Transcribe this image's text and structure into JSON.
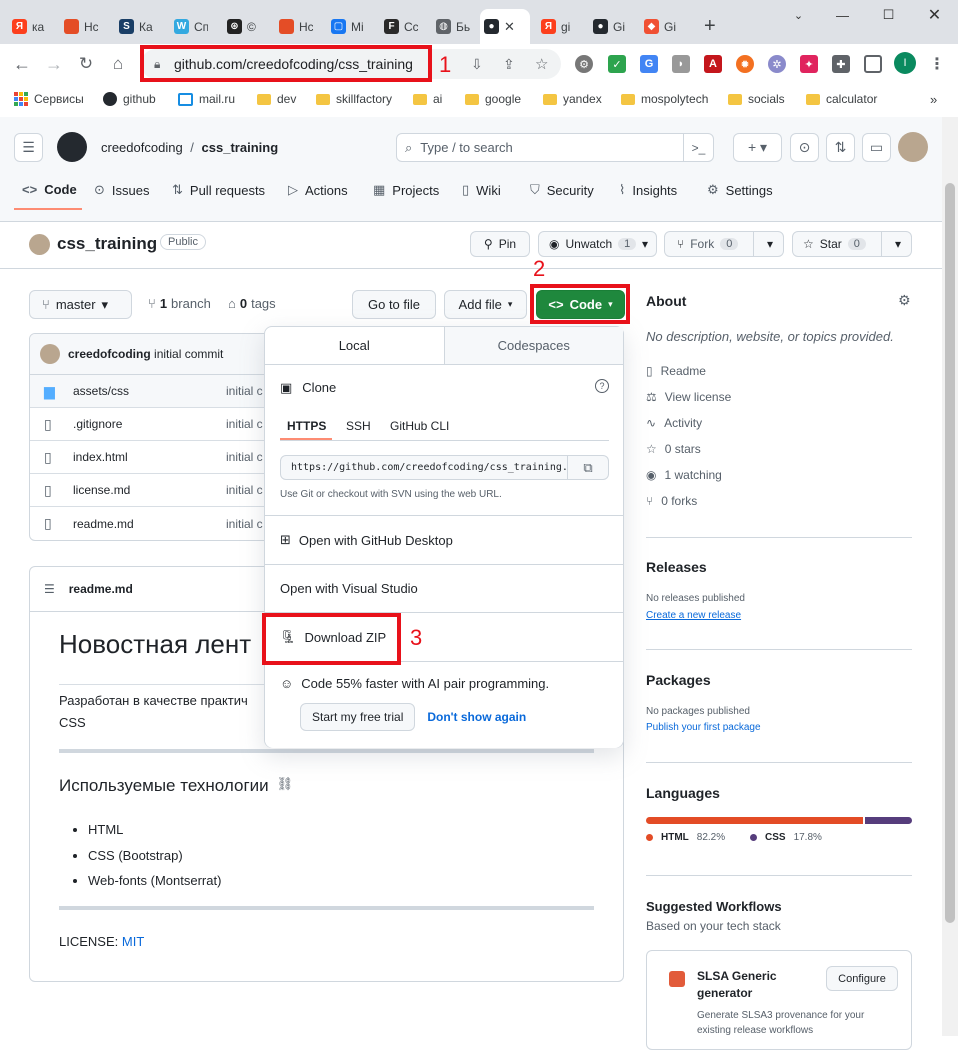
{
  "browser": {
    "tabs": [
      {
        "title": "ка",
        "icon": "yandex-icon",
        "color": "#fc3f1d",
        "glyph": "Я"
      },
      {
        "title": "Нс",
        "icon": "html5-icon",
        "color": "#e44d26",
        "glyph": ""
      },
      {
        "title": "Ка",
        "icon": "stackoverflow-icon",
        "color": "#1a3e66",
        "glyph": "S"
      },
      {
        "title": "Сп",
        "icon": "w-icon",
        "color": "#33a9e0",
        "glyph": "W"
      },
      {
        "title": "©",
        "icon": "openai-icon",
        "color": "#222222",
        "glyph": "⊛"
      },
      {
        "title": "Нс",
        "icon": "html5-icon",
        "color": "#e44d26",
        "glyph": ""
      },
      {
        "title": "Мі",
        "icon": "messenger-icon",
        "color": "#1877f2",
        "glyph": "▢"
      },
      {
        "title": "Сс",
        "icon": "figma-icon",
        "color": "#2a2a2a",
        "glyph": "F"
      },
      {
        "title": "Бь",
        "icon": "globe-icon",
        "color": "#5f6368",
        "glyph": "◍"
      },
      {
        "title": "",
        "icon": "github-icon",
        "color": "#24292f",
        "glyph": "●",
        "active": true
      },
      {
        "title": "gi",
        "icon": "yandex-icon",
        "color": "#fc3f1d",
        "glyph": "Я"
      },
      {
        "title": "Gi",
        "icon": "github-icon",
        "color": "#24292f",
        "glyph": "●"
      },
      {
        "title": "Gi",
        "icon": "git-icon",
        "color": "#f05033",
        "glyph": "◆"
      }
    ],
    "url": "github.com/creedofcoding/css_training",
    "bookmarks": [
      "Сервисы",
      "github",
      "mail.ru",
      "dev",
      "skillfactory",
      "ai",
      "google",
      "yandex",
      "mospolytech",
      "socials",
      "calculator"
    ],
    "profile_letter": "I"
  },
  "annotations": {
    "one": "1",
    "two": "2",
    "three": "3"
  },
  "header": {
    "owner": "creedofcoding",
    "separator": "/",
    "repo": "css_training",
    "search_placeholder": "Type / to search"
  },
  "repo_nav": [
    "Code",
    "Issues",
    "Pull requests",
    "Actions",
    "Projects",
    "Wiki",
    "Security",
    "Insights",
    "Settings"
  ],
  "title_bar": {
    "name": "css_training",
    "visibility": "Public",
    "pin": "Pin",
    "unwatch": "Unwatch",
    "unwatch_count": "1",
    "fork": "Fork",
    "fork_count": "0",
    "star": "Star",
    "star_count": "0"
  },
  "toolbar": {
    "branch": "master",
    "branch_count": "1",
    "branch_label": "branch",
    "tag_count": "0",
    "tag_label": "tags",
    "goto_file": "Go to file",
    "add_file": "Add file",
    "code": "Code"
  },
  "commit": {
    "author": "creedofcoding",
    "message": "initial commit"
  },
  "files": [
    {
      "name": "assets/css",
      "type": "folder",
      "commit": "initial c"
    },
    {
      "name": ".gitignore",
      "type": "file",
      "commit": "initial c"
    },
    {
      "name": "index.html",
      "type": "file",
      "commit": "initial c"
    },
    {
      "name": "license.md",
      "type": "file",
      "commit": "initial c"
    },
    {
      "name": "readme.md",
      "type": "file",
      "commit": "initial c"
    }
  ],
  "readme": {
    "filename": "readme.md",
    "h1": "Новостная лент",
    "para_line1": "Разработан в качестве практич",
    "para_line2": "CSS",
    "h2": "Используемые технологии",
    "list": [
      "HTML",
      "CSS (Bootstrap)",
      "Web-fonts (Montserrat)"
    ],
    "license_label": "LICENSE:",
    "license_link": "MIT"
  },
  "code_dropdown": {
    "tab_local": "Local",
    "tab_codespaces": "Codespaces",
    "clone": "Clone",
    "proto_tabs": [
      "HTTPS",
      "SSH",
      "GitHub CLI"
    ],
    "clone_url": "https://github.com/creedofcoding/css_training.git",
    "clone_hint": "Use Git or checkout with SVN using the web URL.",
    "open_desktop": "Open with GitHub Desktop",
    "open_vs": "Open with Visual Studio",
    "download_zip": "Download ZIP",
    "copilot_text": "Code 55% faster with AI pair programming.",
    "trial": "Start my free trial",
    "dont_show": "Don't show again"
  },
  "about": {
    "title": "About",
    "description": "No description, website, or topics provided.",
    "links": [
      "Readme",
      "View license",
      "Activity",
      "0 stars",
      "1 watching",
      "0 forks"
    ]
  },
  "releases": {
    "title": "Releases",
    "none": "No releases published",
    "link": "Create a new release"
  },
  "packages": {
    "title": "Packages",
    "none": "No packages published",
    "link": "Publish your first package"
  },
  "languages": {
    "title": "Languages",
    "items": [
      {
        "name": "HTML",
        "percent": "82.2%",
        "value": 82.2,
        "color": "#e34c26"
      },
      {
        "name": "CSS",
        "percent": "17.8%",
        "value": 17.8,
        "color": "#563d7c"
      }
    ]
  },
  "workflows": {
    "title": "Suggested Workflows",
    "subtitle": "Based on your tech stack",
    "card_title_1": "SLSA Generic",
    "card_title_2": "generator",
    "card_desc_1": "Generate SLSA3 provenance for your",
    "card_desc_2": "existing release workflows",
    "configure": "Configure"
  }
}
